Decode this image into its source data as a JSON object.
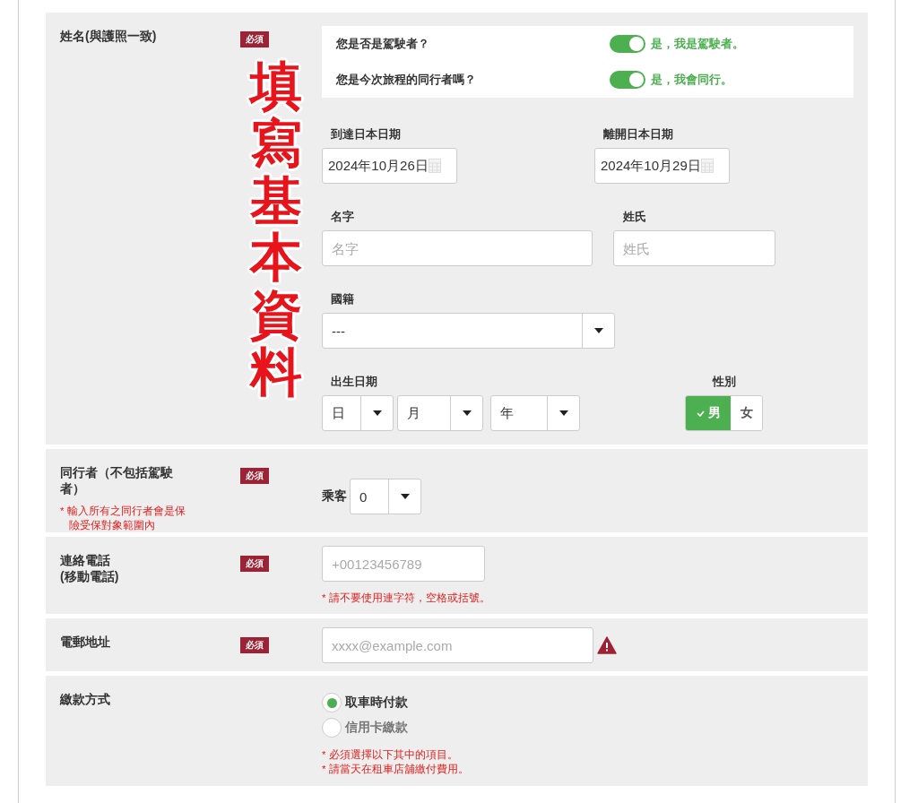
{
  "annotation": "填寫基本資料",
  "sections": [
    {
      "kind": "name",
      "label": "姓名(與護照一致)",
      "badge": "必須",
      "toggles": [
        {
          "question": "您是否是駕駛者？",
          "answer": "是，我是駕駛者。",
          "on": true
        },
        {
          "question": "您是今次旅程的同行者嗎？",
          "answer": "是，我會同行。",
          "on": true
        }
      ],
      "dates": [
        {
          "label": "到達日本日期",
          "value": "2024年10月26日"
        },
        {
          "label": "離開日本日期",
          "value": "2024年10月29日"
        }
      ],
      "names": [
        {
          "label": "名字",
          "placeholder": "名字"
        },
        {
          "label": "姓氏",
          "placeholder": "姓氏"
        }
      ],
      "nationality": {
        "label": "國籍",
        "value": "---"
      },
      "birth_date": {
        "label": "出生日期",
        "selects": [
          "日",
          "月",
          "年"
        ]
      },
      "gender": {
        "label": "性別",
        "options": [
          {
            "label": "男",
            "selected": true
          },
          {
            "label": "女",
            "selected": false
          }
        ]
      }
    },
    {
      "kind": "companions",
      "label": "同行者（不包括駕駛者）",
      "badge": "必須",
      "note": "* 輸入所有之同行者會是保險受保對象範圍內",
      "field_label": "乘客",
      "value": "0"
    },
    {
      "kind": "phone",
      "label": "連絡電話\n(移動電話)",
      "badge": "必須",
      "placeholder": "+00123456789",
      "notes": [
        "* 請不要使用連字符，空格或括號。"
      ]
    },
    {
      "kind": "email",
      "label": "電郵地址",
      "badge": "必須",
      "placeholder": "xxxx@example.com",
      "invalid": true
    },
    {
      "kind": "payment",
      "label": "繳款方式",
      "options": [
        {
          "label": "取車時付款",
          "selected": true
        },
        {
          "label": "信用卡繳款",
          "selected": false
        }
      ],
      "notes": [
        "* 必須選擇以下其中的項目。",
        "* 請當天在租車店舖繳付費用。"
      ]
    }
  ]
}
